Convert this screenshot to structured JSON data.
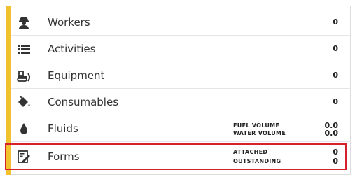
{
  "rows": [
    {
      "label": "Workers",
      "value": "0",
      "icon": "worker-icon"
    },
    {
      "label": "Activities",
      "value": "0",
      "icon": "list-icon"
    },
    {
      "label": "Equipment",
      "value": "0",
      "icon": "bulldozer-icon"
    },
    {
      "label": "Consumables",
      "value": "0",
      "icon": "paint-bucket-icon"
    },
    {
      "label": "Fluids",
      "icon": "drop-icon",
      "sub": [
        {
          "label": "FUEL VOLUME",
          "value": "0.0"
        },
        {
          "label": "WATER VOLUME",
          "value": "0.0"
        }
      ]
    },
    {
      "label": "Forms",
      "icon": "form-edit-icon",
      "sub": [
        {
          "label": "ATTACHED",
          "value": "0"
        },
        {
          "label": "OUTSTANDING",
          "value": "0"
        }
      ]
    }
  ],
  "colors": {
    "accent": "#f2c12e",
    "highlight": "#d6202a"
  }
}
